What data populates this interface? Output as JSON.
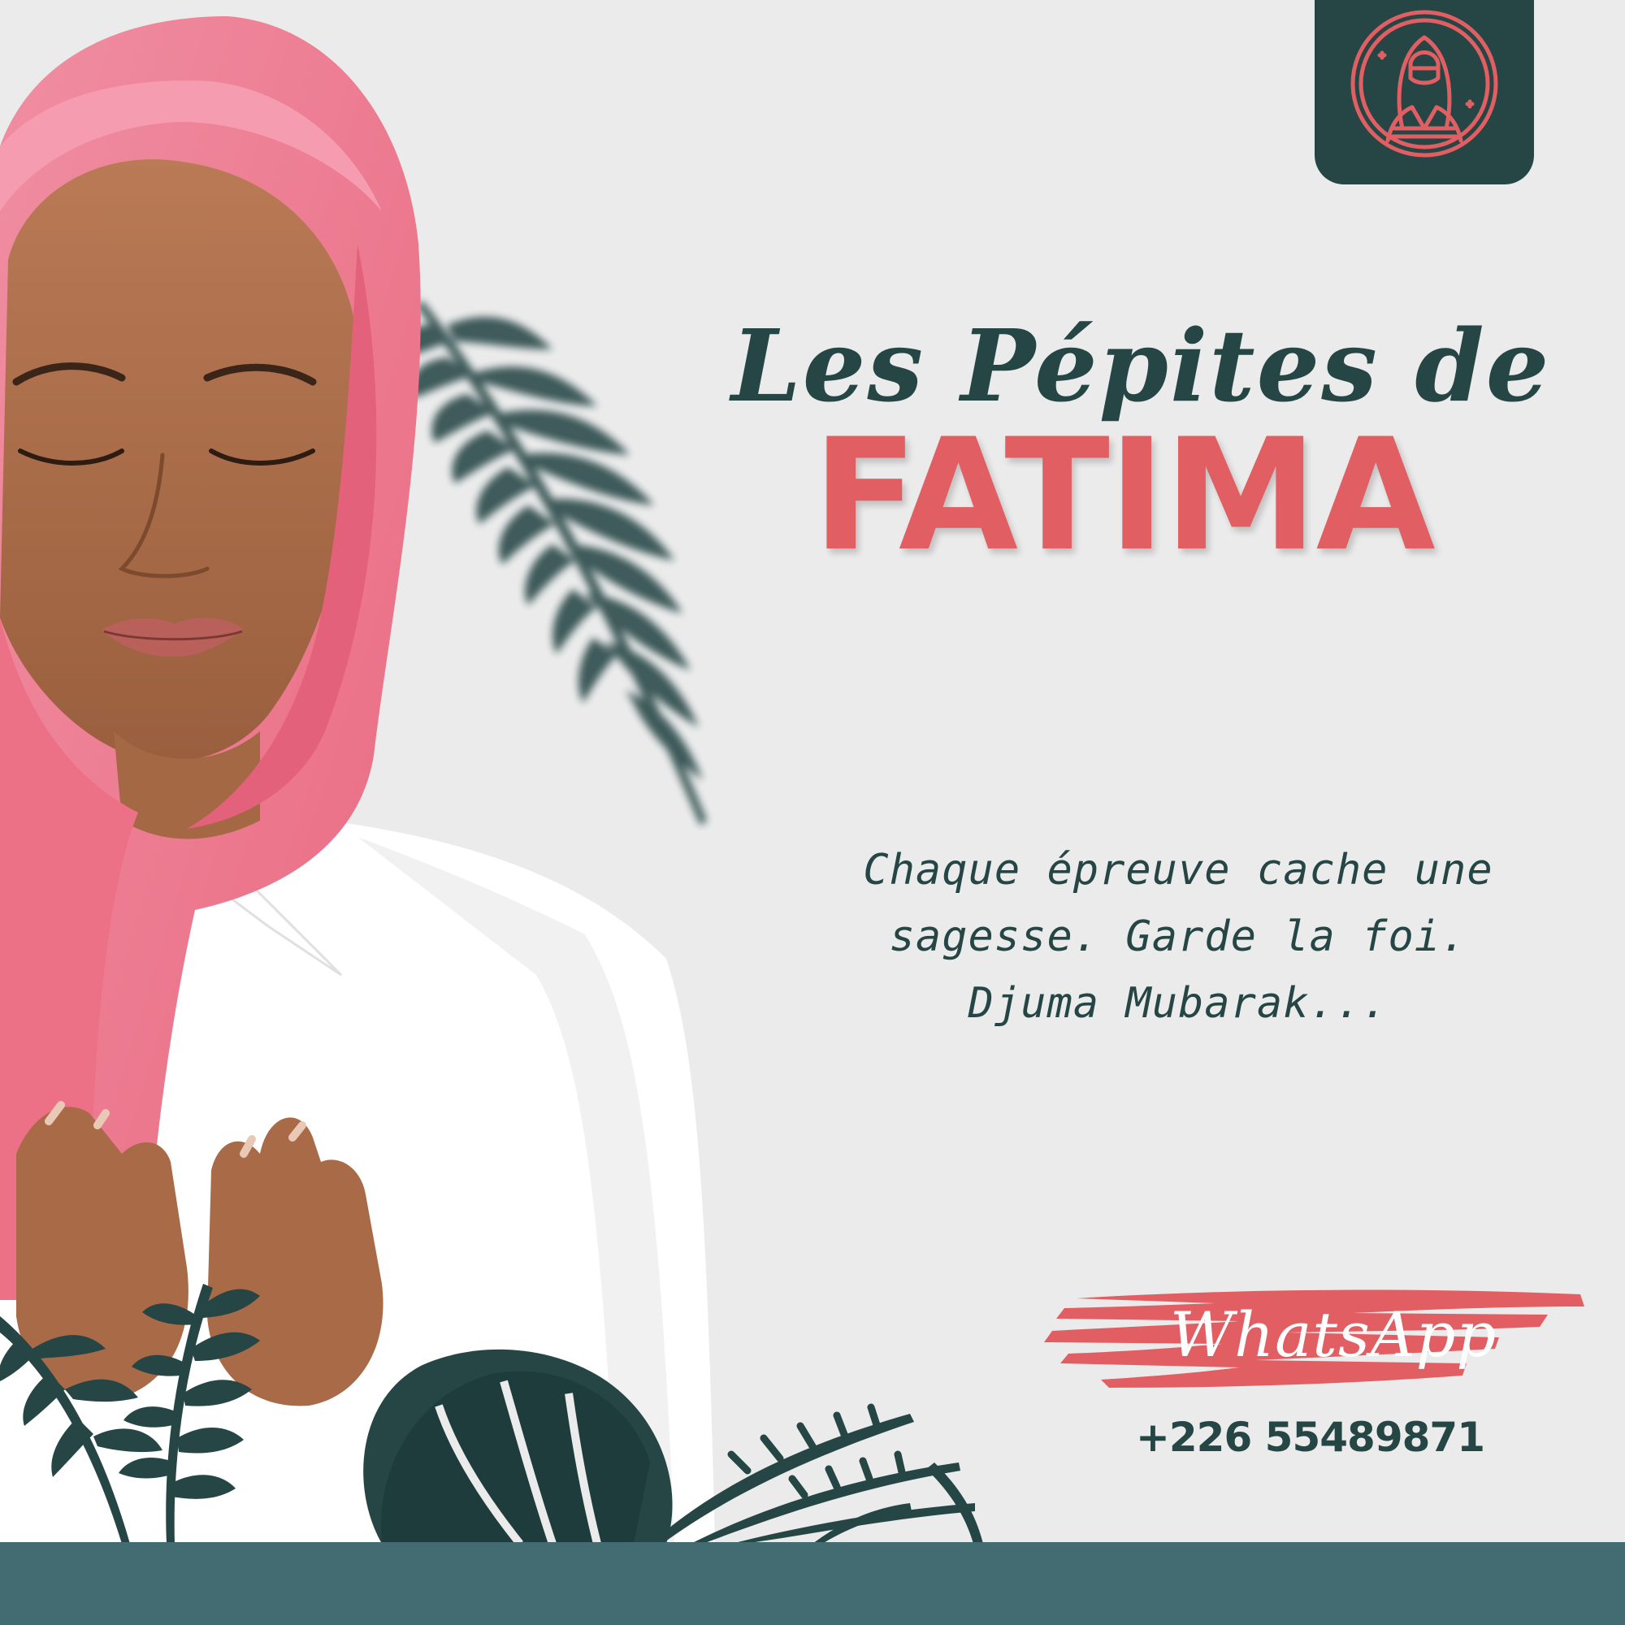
{
  "colors": {
    "background": "#ebebeb",
    "dark_teal": "#264646",
    "coral": "#e15f62",
    "band": "#426b72",
    "white": "#ffffff"
  },
  "logo": {
    "icon": "veiled-woman-icon"
  },
  "title": {
    "line1": "Les Pépites de",
    "line2": "FATIMA"
  },
  "quote": {
    "line1": "Chaque épreuve cache une",
    "line2": "sagesse. Garde la foi.",
    "line3": "Djuma Mubarak..."
  },
  "contact": {
    "label": "WhatsApp",
    "phone": "+226 55489871"
  }
}
